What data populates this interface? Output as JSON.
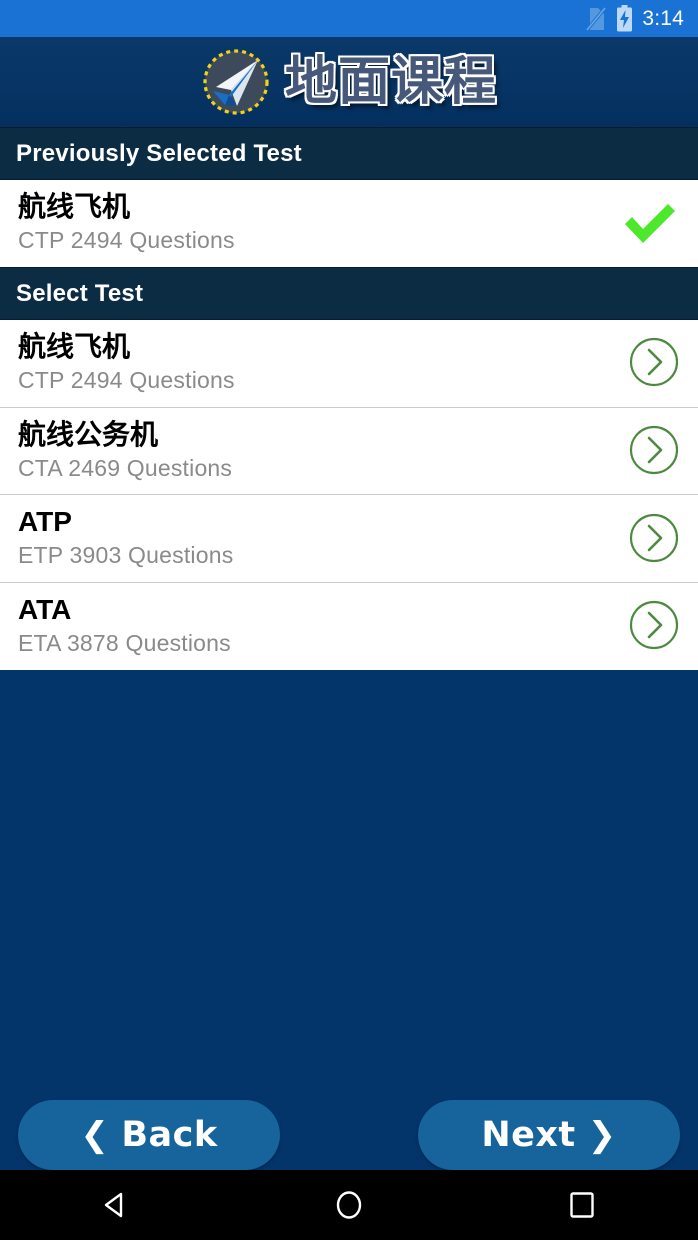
{
  "status_bar": {
    "time": "3:14",
    "icons": [
      "no-sim-icon",
      "battery-charging-icon"
    ],
    "background_color": "#1a73d4"
  },
  "app_header": {
    "title": "地面课程",
    "logo": "paper-airplane-logo",
    "background_color": "#0a3562"
  },
  "sections": [
    {
      "header": "Previously Selected Test",
      "rows": [
        {
          "title": "航线飞机",
          "subtitle": "CTP  2494 Questions",
          "code": "CTP",
          "questions": 2494,
          "accessory": "check-icon"
        }
      ]
    },
    {
      "header": "Select Test",
      "rows": [
        {
          "title": "航线飞机",
          "subtitle": "CTP  2494 Questions",
          "code": "CTP",
          "questions": 2494,
          "accessory": "chevron-right-circle-icon"
        },
        {
          "title": "航线公务机",
          "subtitle": "CTA  2469 Questions",
          "code": "CTA",
          "questions": 2469,
          "accessory": "chevron-right-circle-icon"
        },
        {
          "title": "ATP",
          "subtitle": "ETP  3903 Questions",
          "code": "ETP",
          "questions": 3903,
          "accessory": "chevron-right-circle-icon"
        },
        {
          "title": "ATA",
          "subtitle": "ETA  3878 Questions",
          "code": "ETA",
          "questions": 3878,
          "accessory": "chevron-right-circle-icon"
        }
      ]
    }
  ],
  "footer": {
    "back_label": "Back",
    "back_glyph": "❮",
    "next_label": "Next",
    "next_glyph": "❯",
    "button_color": "#17639b"
  },
  "android_nav": {
    "back": "back-triangle",
    "home": "home-circle",
    "recents": "recents-square"
  },
  "colors": {
    "page_background": "#03356b",
    "section_header": "#0c2c44",
    "accent_green": "#4ce82b",
    "chevron_green": "#4c8a40",
    "subtitle_gray": "#8a8a8a"
  }
}
